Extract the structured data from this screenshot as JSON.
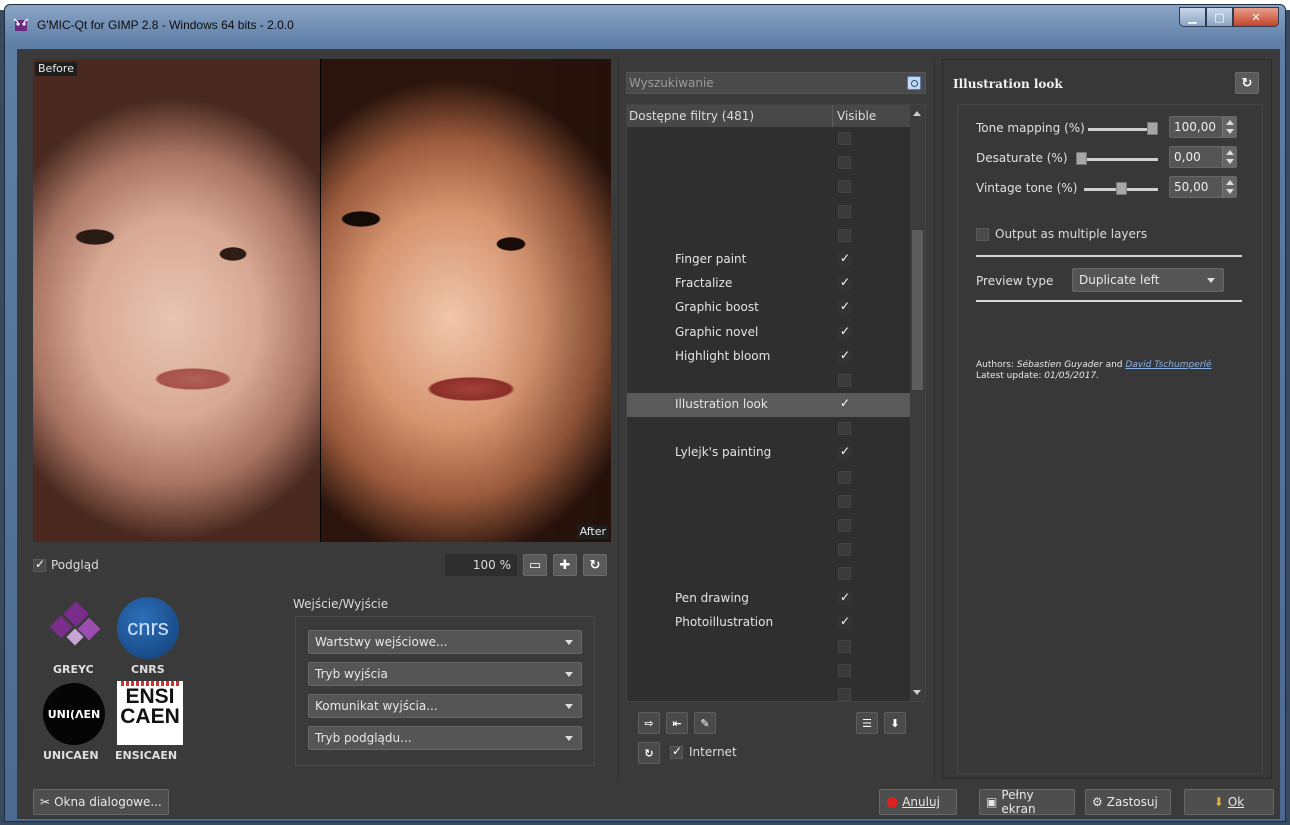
{
  "window": {
    "title": "G'MIC-Qt for GIMP 2.8 - Windows 64 bits - 2.0.0"
  },
  "preview": {
    "before_label": "Before",
    "after_label": "After"
  },
  "preview_controls": {
    "checkbox_label": "Podgląd",
    "checked": true,
    "zoom": "100 %"
  },
  "logos": {
    "greyc": "GREYC",
    "cnrs": "CNRS",
    "cnrs_mark": "cnrs",
    "unicaen": "UNICAEN",
    "unicaen_mark": "UNI(ΛEN",
    "ensicaen": "ENSICAEN",
    "ensi_mark": "ENSI CAEN"
  },
  "io": {
    "label": "Wejście/Wyjście",
    "input_layers": "Wartstwy wejściowe...",
    "output_mode": "Tryb wyjścia",
    "output_messages": "Komunikat wyjścia...",
    "preview_mode": "Tryb podglądu..."
  },
  "filters": {
    "search_placeholder": "Wyszukiwanie",
    "col_name": "Dostępne filtry (481)",
    "col_visible": "Visible",
    "rows": [
      {
        "name": "",
        "checked": false
      },
      {
        "name": "",
        "checked": false
      },
      {
        "name": "",
        "checked": false
      },
      {
        "name": "",
        "checked": false
      },
      {
        "name": "",
        "checked": false
      },
      {
        "name": "Finger paint",
        "checked": true
      },
      {
        "name": "Fractalize",
        "checked": true
      },
      {
        "name": "Graphic boost",
        "checked": true
      },
      {
        "name": "Graphic novel",
        "checked": true
      },
      {
        "name": "Highlight bloom",
        "checked": true
      },
      {
        "name": "",
        "checked": false
      },
      {
        "name": "Illustration look",
        "checked": true,
        "selected": true
      },
      {
        "name": "",
        "checked": false
      },
      {
        "name": "Lylejk's painting",
        "checked": true
      },
      {
        "name": "",
        "checked": false
      },
      {
        "name": "",
        "checked": false
      },
      {
        "name": "",
        "checked": false
      },
      {
        "name": "",
        "checked": false
      },
      {
        "name": "",
        "checked": false
      },
      {
        "name": "Pen drawing",
        "checked": true
      },
      {
        "name": "Photoillustration",
        "checked": true
      },
      {
        "name": "",
        "checked": false
      },
      {
        "name": "",
        "checked": false
      },
      {
        "name": "",
        "checked": false
      }
    ],
    "internet_label": "Internet",
    "internet_checked": true
  },
  "settings": {
    "title": "Illustration look",
    "params": [
      {
        "label": "Tone mapping (%)",
        "value": "100,00",
        "fraction": 1.0
      },
      {
        "label": "Desaturate (%)",
        "value": "0,00",
        "fraction": 0.0
      },
      {
        "label": "Vintage tone (%)",
        "value": "50,00",
        "fraction": 0.5
      }
    ],
    "multiple_layers_label": "Output as multiple layers",
    "multiple_layers_checked": false,
    "preview_type_label": "Preview type",
    "preview_type_value": "Duplicate left",
    "authors_label": "Authors:",
    "author1": "Sébastien Guyader",
    "and": "and",
    "author2": "David Tschumperlé",
    "update_label": "Latest update:",
    "update_date": "01/05/2017."
  },
  "buttons": {
    "dialogs": "Okna dialogowe...",
    "cancel": "Anuluj",
    "fullscreen": "Pełny ekran",
    "apply": "Zastosuj",
    "ok": "Ok"
  }
}
